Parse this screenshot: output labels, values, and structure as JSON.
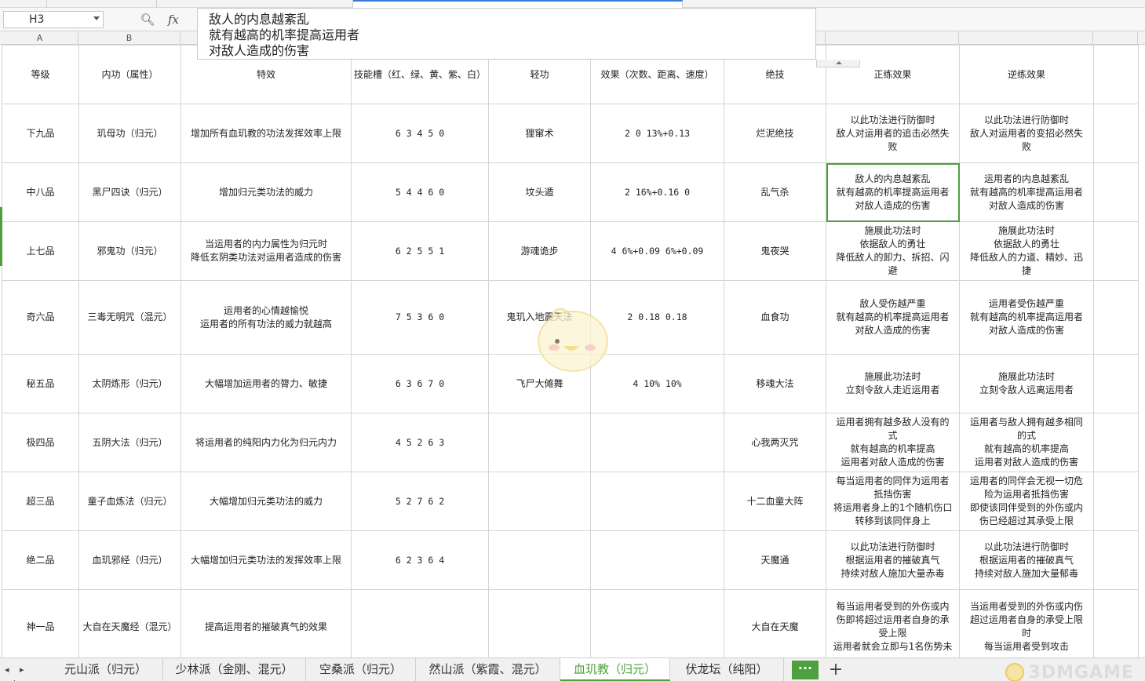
{
  "namebox": {
    "cell": "H3"
  },
  "formula": {
    "fx_symbol": "fx",
    "lines": [
      "敌人的内息越紊乱",
      "就有越高的机率提高运用者",
      "对敌人造成的伤害"
    ]
  },
  "columns": [
    "A",
    "B"
  ],
  "headers": [
    "等级",
    "内功（属性）",
    "特效",
    "技能槽（红、绿、黄、紫、白）",
    "轻功",
    "效果（次数、距离、速度）",
    "绝技",
    "正练效果",
    "逆练效果"
  ],
  "rows": [
    {
      "grade": "下九品",
      "art": "玑母功（归元）",
      "effect": [
        "增加所有血玑教的功法发挥效率上限"
      ],
      "slots": "6   3   4   5   0",
      "qinggong": "狸窜术",
      "qg_effect": "2   0   13%+0.13",
      "ultimate": "烂泥绝技",
      "forward": [
        "以此功法进行防御时",
        "敌人对运用者的追击必然失",
        "败"
      ],
      "reverse": [
        "以此功法进行防御时",
        "敌人对运用者的变招必然失",
        "败"
      ]
    },
    {
      "grade": "中八品",
      "art": "黑尸四诀（归元）",
      "effect": [
        "增加归元类功法的威力"
      ],
      "slots": "5   4   4   6   0",
      "qinggong": "坟头遁",
      "qg_effect": "2   16%+0.16   0",
      "ultimate": "乱气杀",
      "forward": [
        "敌人的内息越紊乱",
        "就有越高的机率提高运用者",
        "对敌人造成的伤害"
      ],
      "reverse": [
        "运用者的内息越紊乱",
        "就有越高的机率提高运用者",
        "对敌人造成的伤害"
      ]
    },
    {
      "grade": "上七品",
      "art": "邪鬼功（归元）",
      "effect": [
        "当运用者的内力属性为归元时",
        "降低玄阴类功法对运用者造成的伤害"
      ],
      "slots": "6   2   5   5   1",
      "qinggong": "游魂诡步",
      "qg_effect": "4   6%+0.09   6%+0.09",
      "ultimate": "鬼夜哭",
      "forward": [
        "施展此功法时",
        "依据敌人的勇壮",
        "降低敌人的卸力、拆招、闪",
        "避"
      ],
      "reverse": [
        "施展此功法时",
        "依据敌人的勇壮",
        "降低敌人的力道、精妙、迅",
        "捷"
      ]
    },
    {
      "grade": "奇六品",
      "art": "三毒无明咒（混元）",
      "effect": [
        "运用者的心情越愉悦",
        "运用者的所有功法的威力就越高"
      ],
      "slots": "7   5   3   6   0",
      "qinggong": "鬼玑入地震天法",
      "qg_effect": "2   0.18   0.18",
      "ultimate": "血食功",
      "forward": [
        "敌人受伤越严重",
        "就有越高的机率提高运用者",
        "对敌人造成的伤害"
      ],
      "reverse": [
        "运用者受伤越严重",
        "就有越高的机率提高运用者",
        "对敌人造成的伤害"
      ]
    },
    {
      "grade": "秘五品",
      "art": "太阴炼形（归元）",
      "effect": [
        "大幅增加运用者的膂力、敏捷"
      ],
      "slots": "6   3   6   7   0",
      "qinggong": "飞尸大傩舞",
      "qg_effect": "4   10%   10%",
      "ultimate": "移魂大法",
      "forward": [
        "施展此功法时",
        "立刻令敌人走近运用者"
      ],
      "reverse": [
        "施展此功法时",
        "立刻令敌人远离运用者"
      ]
    },
    {
      "grade": "极四品",
      "art": "五阴大法（归元）",
      "effect": [
        "将运用者的纯阳内力化为归元内力"
      ],
      "slots": "4   5   2   6   3",
      "qinggong": "",
      "qg_effect": "",
      "ultimate": "心我两灭咒",
      "forward": [
        "运用者拥有越多敌人没有的",
        "式",
        "就有越高的机率提高",
        "运用者对敌人造成的伤害"
      ],
      "reverse": [
        "运用者与敌人拥有越多相同",
        "的式",
        "就有越高的机率提高",
        "运用者对敌人造成的伤害"
      ]
    },
    {
      "grade": "超三品",
      "art": "童子血炼法（归元）",
      "effect": [
        "大幅增加归元类功法的威力"
      ],
      "slots": "5   2   7   6   2",
      "qinggong": "",
      "qg_effect": "",
      "ultimate": "十二血童大阵",
      "forward": [
        "每当运用者的同伴为运用者",
        "抵挡伤害",
        "将运用者身上的1个随机伤口",
        "转移到该同伴身上"
      ],
      "reverse": [
        "运用者的同伴会无视一切危",
        "险为运用者抵挡伤害",
        "即使该同伴受到的外伤或内",
        "伤已经超过其承受上限"
      ]
    },
    {
      "grade": "绝二品",
      "art": "血玑邪经（归元）",
      "effect": [
        "大幅增加归元类功法的发挥效率上限"
      ],
      "slots": "6   2   3   6   4",
      "qinggong": "",
      "qg_effect": "",
      "ultimate": "天魔通",
      "forward": [
        "以此功法进行防御时",
        "根据运用者的摧破真气",
        "持续对敌人施加大量赤毒"
      ],
      "reverse": [
        "以此功法进行防御时",
        "根据运用者的摧破真气",
        "持续对敌人施加大量郁毒"
      ]
    },
    {
      "grade": "神一品",
      "art": "大自在天魔经（混元）",
      "effect": [
        "提高运用者的摧破真气的效果"
      ],
      "slots": "",
      "qinggong": "",
      "qg_effect": "",
      "ultimate": "大自在天魔",
      "forward": [
        "每当运用者受到的外伤或内",
        "伤即将超过运用者自身的承",
        "受上限",
        "运用者就会立即与1名伤势未"
      ],
      "reverse": [
        "当运用者受到的外伤或内伤",
        "超过运用者自身的承受上限",
        "时",
        "每当运用者受到攻击"
      ]
    }
  ],
  "sheet_nav": "◂ ▸ ▸|",
  "sheets": [
    "元山派（归元）",
    "少林派（金刚、混元）",
    "空桑派（归元）",
    "然山派（紫霞、混元）",
    "血玑教（归元）",
    "伏龙坛（纯阳）"
  ],
  "active_sheet": 4,
  "more_label": "···",
  "add_label": "+",
  "watermark": "3DMGAME",
  "accent_color": "#4ea03e"
}
